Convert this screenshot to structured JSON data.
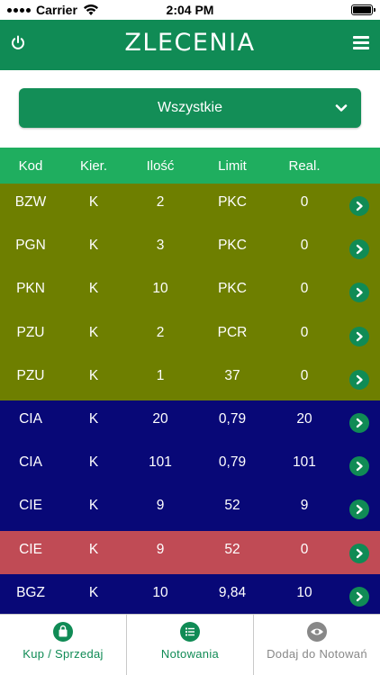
{
  "status_bar": {
    "carrier": "Carrier",
    "time": "2:04 PM"
  },
  "navbar": {
    "title": "ZLECENIA",
    "left_icon": "power-icon",
    "right_icon": "menu-icon"
  },
  "filter": {
    "selected": "Wszystkie"
  },
  "table": {
    "headers": {
      "kod": "Kod",
      "kier": "Kier.",
      "ilosc": "Ilość",
      "limit": "Limit",
      "real": "Real."
    },
    "rows": [
      {
        "kod": "BZW",
        "kier": "K",
        "ilosc": "2",
        "limit": "PKC",
        "real": "0",
        "color": "#6e7f00"
      },
      {
        "kod": "PGN",
        "kier": "K",
        "ilosc": "3",
        "limit": "PKC",
        "real": "0",
        "color": "#6e7f00"
      },
      {
        "kod": "PKN",
        "kier": "K",
        "ilosc": "10",
        "limit": "PKC",
        "real": "0",
        "color": "#6e7f00"
      },
      {
        "kod": "PZU",
        "kier": "K",
        "ilosc": "2",
        "limit": "PCR",
        "real": "0",
        "color": "#6e7f00"
      },
      {
        "kod": "PZU",
        "kier": "K",
        "ilosc": "1",
        "limit": "37",
        "real": "0",
        "color": "#6e7f00"
      },
      {
        "kod": "CIA",
        "kier": "K",
        "ilosc": "20",
        "limit": "0,79",
        "real": "20",
        "color": "#080877"
      },
      {
        "kod": "CIA",
        "kier": "K",
        "ilosc": "101",
        "limit": "0,79",
        "real": "101",
        "color": "#080877"
      },
      {
        "kod": "CIE",
        "kier": "K",
        "ilosc": "9",
        "limit": "52",
        "real": "9",
        "color": "#080877"
      },
      {
        "kod": "CIE",
        "kier": "K",
        "ilosc": "9",
        "limit": "52",
        "real": "0",
        "color": "#c04b55"
      },
      {
        "kod": "BGZ",
        "kier": "K",
        "ilosc": "10",
        "limit": "9,84",
        "real": "10",
        "color": "#080877"
      }
    ]
  },
  "tabbar": {
    "tabs": [
      {
        "label": "Kup / Sprzedaj",
        "icon": "shopping-bag-icon",
        "active": true
      },
      {
        "label": "Notowania",
        "icon": "list-icon",
        "active": true
      },
      {
        "label": "Dodaj do Notowań",
        "icon": "eye-icon",
        "active": false
      }
    ]
  },
  "colors": {
    "primary_green": "#108b55",
    "header_green": "#1fae5f",
    "olive": "#6e7f00",
    "navy": "#080877",
    "red": "#c04b55"
  }
}
